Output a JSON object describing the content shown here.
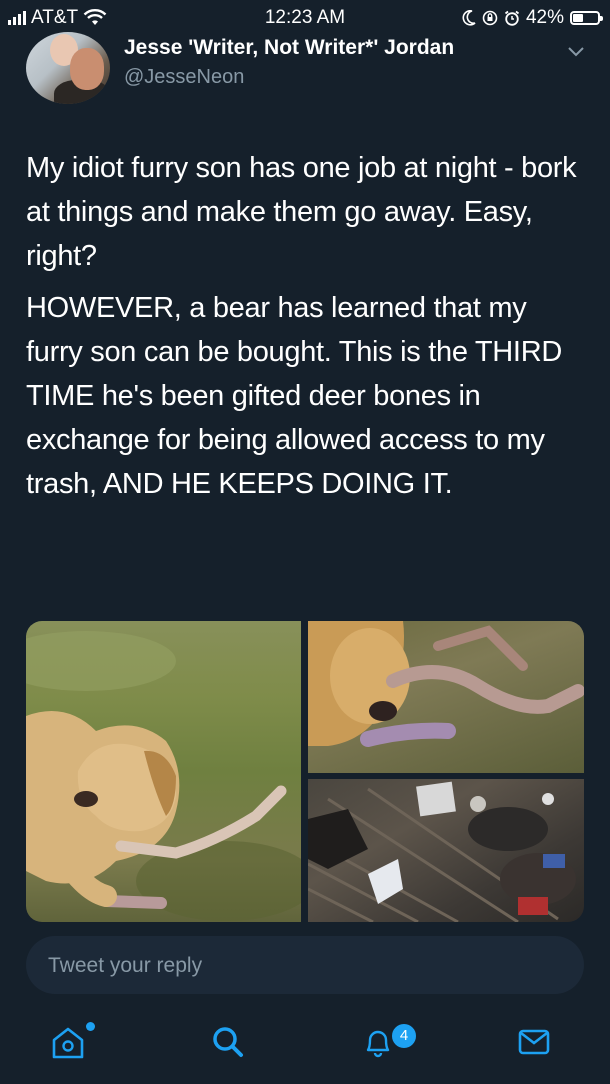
{
  "status_bar": {
    "carrier": "AT&T",
    "time": "12:23 AM",
    "battery_percent": "42%",
    "battery_level": 0.42
  },
  "tweet": {
    "display_name": "Jesse 'Writer, Not Writer*' Jordan",
    "handle": "@JesseNeon",
    "paragraphs": [
      "My idiot furry son has one job at night - bork at things and make them go away. Easy, right?",
      "HOWEVER, a bear has learned that my furry son can be bought. This is the THIRD TIME he's been gifted deer bones in exchange for being allowed access to my trash, AND HE KEEPS DOING IT."
    ]
  },
  "composer": {
    "placeholder": "Tweet your reply"
  },
  "tab_bar": {
    "notifications_count": "4"
  },
  "colors": {
    "background": "#15202b",
    "accent": "#1da1f2",
    "secondary_text": "#8899a6",
    "composer_bg": "#1c2938"
  }
}
